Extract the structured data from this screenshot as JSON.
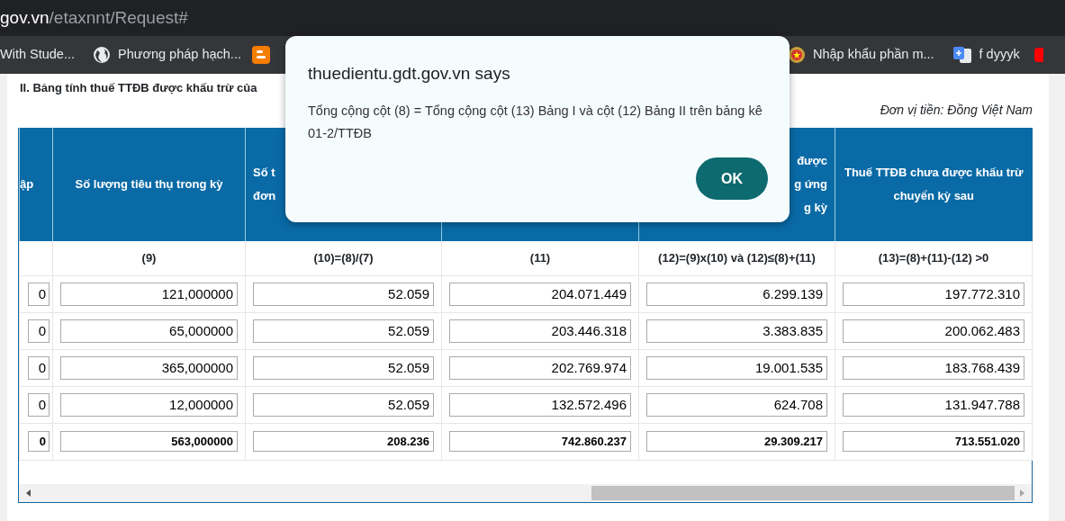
{
  "address_bar": {
    "host": "gov.vn",
    "path": "/etaxnnt/Request#"
  },
  "bookmarks": [
    {
      "kind": "none",
      "label": "With Stude..."
    },
    {
      "kind": "globe",
      "label": "Phương pháp hạch..."
    },
    {
      "kind": "blogger"
    },
    {
      "kind": "emblem",
      "label": "Nhập khẩu phần m..."
    },
    {
      "kind": "translate",
      "label": "f dyyyk"
    },
    {
      "kind": "video"
    }
  ],
  "page": {
    "heading": "II. Bảng tính thuế TTĐB được khấu trừ của",
    "currency_note": "Đơn vị tiền: Đồng Việt Nam"
  },
  "table": {
    "columns": [
      {
        "lines": [
          "ập"
        ]
      },
      {
        "lines": [
          "Số lượng tiêu thụ trong kỳ"
        ],
        "formula": "(9)"
      },
      {
        "lines": [
          "Số t",
          "đơn"
        ],
        "formula": "(10)=(8)/(7)"
      },
      {
        "formula": "(11)"
      },
      {
        "lines": [
          "được",
          "g ứng",
          "g kỳ"
        ],
        "formula": "(12)=(9)x(10) và (12)≤(8)+(11)"
      },
      {
        "lines": [
          "Thuế TTĐB chưa được khấu trừ chuyển kỳ sau"
        ],
        "formula": "(13)=(8)+(11)-(12) >0"
      }
    ],
    "rows": [
      [
        "0",
        "121,000000",
        "52.059",
        "204.071.449",
        "6.299.139",
        "197.772.310"
      ],
      [
        "0",
        "65,000000",
        "52.059",
        "203.446.318",
        "3.383.835",
        "200.062.483"
      ],
      [
        "0",
        "365,000000",
        "52.059",
        "202.769.974",
        "19.001.535",
        "183.768.439"
      ],
      [
        "0",
        "12,000000",
        "52.059",
        "132.572.496",
        "624.708",
        "131.947.788"
      ]
    ],
    "total": [
      "0",
      "563,000000",
      "208.236",
      "742.860.237",
      "29.309.217",
      "713.551.020"
    ]
  },
  "dialog": {
    "title": "thuedientu.gdt.gov.vn says",
    "message": "Tổng cộng cột (8) = Tổng cộng cột (13) Bảng I và cột (12) Bảng II trên bảng kê 01-2/TTĐB",
    "button": "OK"
  }
}
